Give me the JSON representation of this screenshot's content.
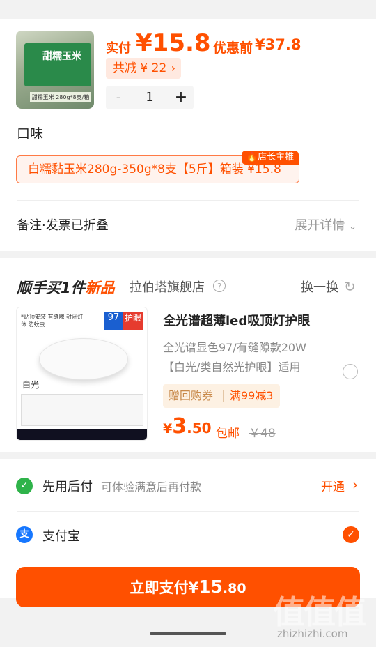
{
  "product": {
    "thumbnail_text": "甜糯玉米",
    "thumbnail_sub": "甜糯玉米 280g*8支/箱",
    "price_label": "实付",
    "price": "¥15.8",
    "original_label": "优惠前",
    "original_price": "¥37.8",
    "save_text": "共减 ¥ 22",
    "quantity": "1",
    "minus": "-",
    "plus": "+"
  },
  "flavor": {
    "title": "口味",
    "option": "白糯黏玉米280g-350g*8支【5斤】箱装 ¥15.8",
    "badge": "店长主推"
  },
  "notes": {
    "label": "备注·发票已折叠",
    "expand": "展开详情"
  },
  "addon": {
    "title_prefix": "顺手买1件",
    "title_accent": "新品",
    "shop": "拉伯塔旗舰店",
    "swap": "换一换",
    "product_title": "全光谱超薄led吸顶灯护眼",
    "product_sub1": "全光谱显色97/有缝隙款20W",
    "product_sub2": "【白光/类自然光护眼】适用",
    "tag1": "赠回购券",
    "tag2": "满99减3",
    "price_currency": "¥",
    "price_int": "3",
    "price_dec": ".50",
    "free_ship": "包邮",
    "strike_price": "￥48",
    "lamp": {
      "head": "*贴顶安装 有缝隙 封闭灯体 防蚊虫",
      "badge97": "97",
      "badge_eye": "护眼",
      "light": "白光"
    }
  },
  "payment": {
    "later_label": "先用后付",
    "later_desc": "可体验满意后再付款",
    "later_link": "开通",
    "alipay_label": "支付宝",
    "pay_button_prefix": "立即支付",
    "pay_button_currency": "¥",
    "pay_button_int": "15",
    "pay_button_dec": ".80"
  },
  "watermark": {
    "zh": "值值值",
    "en": "zhizhizhi.com"
  },
  "colors": {
    "accent": "#ff5000",
    "later_green": "#2fb34a",
    "alipay_blue": "#1677ff"
  }
}
